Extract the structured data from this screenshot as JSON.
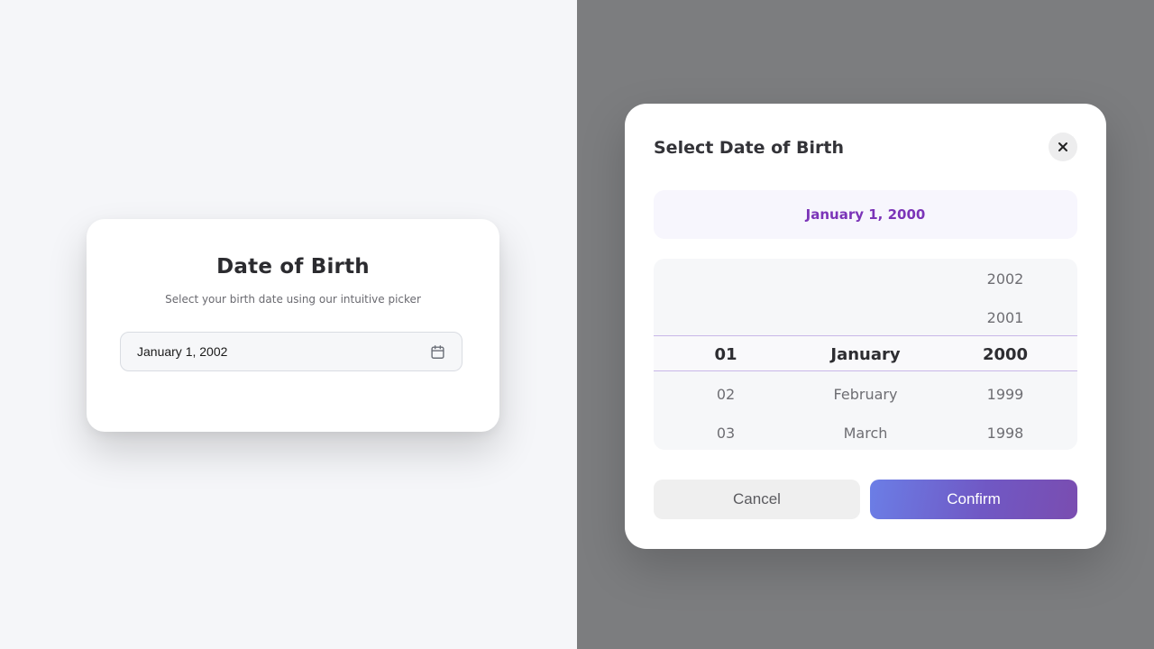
{
  "card": {
    "title": "Date of Birth",
    "subtitle": "Select your birth date using our intuitive picker",
    "input_value": "January 1, 2002",
    "input_icon": "calendar-icon"
  },
  "modal": {
    "title": "Select Date of Birth",
    "close_icon": "close-icon",
    "selected_display": "January 1, 2000",
    "picker": {
      "days": [
        "",
        "",
        "01",
        "02",
        "03"
      ],
      "months": [
        "",
        "",
        "January",
        "February",
        "March"
      ],
      "years": [
        "2002",
        "2001",
        "2000",
        "1999",
        "1998"
      ],
      "selected_index": 2
    },
    "cancel_label": "Cancel",
    "confirm_label": "Confirm"
  },
  "colors": {
    "accent_text": "#7b34b8",
    "confirm_gradient_start": "#6b7ee6",
    "confirm_gradient_end": "#7a4db0",
    "highlight_border": "#c9b7e8",
    "overlay": "#7c7d7f"
  }
}
